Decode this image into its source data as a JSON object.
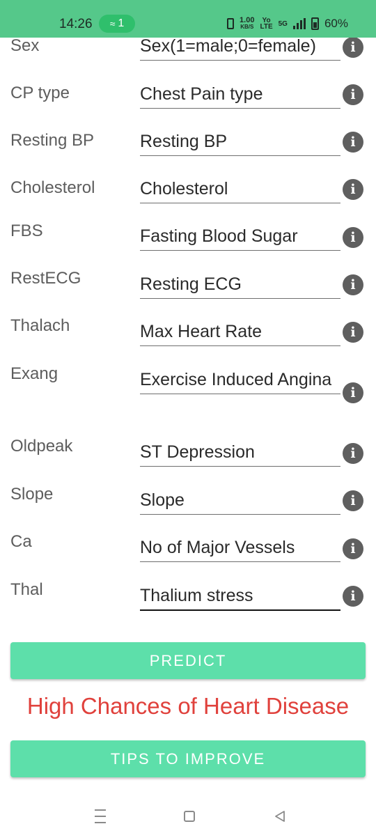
{
  "status_bar": {
    "time": "14:26",
    "hotspot_count": "1",
    "net_speed_value": "1.00",
    "net_speed_unit": "KB/S",
    "volte_top": "Yo",
    "volte_bottom": "LTE",
    "network_type": "5G",
    "battery_percent": "60%"
  },
  "form": {
    "rows": [
      {
        "label": "Sex",
        "hint": "Sex(1=male;0=female)"
      },
      {
        "label": "CP type",
        "hint": "Chest Pain type"
      },
      {
        "label": "Resting BP",
        "hint": "Resting BP"
      },
      {
        "label": "Cholesterol",
        "hint": "Cholesterol"
      },
      {
        "label": "FBS",
        "hint": "Fasting Blood Sugar"
      },
      {
        "label": "RestECG",
        "hint": "Resting ECG"
      },
      {
        "label": "Thalach",
        "hint": "Max Heart Rate"
      },
      {
        "label": "Exang",
        "hint": "Exercise Induced Angina"
      },
      {
        "label": "Oldpeak",
        "hint": "ST Depression"
      },
      {
        "label": "Slope",
        "hint": "Slope"
      },
      {
        "label": "Ca",
        "hint": "No of Major Vessels"
      },
      {
        "label": "Thal",
        "hint": "Thalium stress"
      }
    ],
    "info_glyph": "i"
  },
  "actions": {
    "predict_label": "PREDICT",
    "tips_label": "TIPS TO IMPROVE"
  },
  "result": {
    "text": "High Chances of Heart Disease",
    "color": "#e0413c"
  },
  "colors": {
    "status_bar": "#55c88a",
    "button": "#5ddfaa",
    "info_icon": "#5f5f5f"
  },
  "icons": {
    "nav_recents": "menu-lines-icon",
    "nav_home": "square-home-icon",
    "nav_back": "triangle-back-icon"
  }
}
